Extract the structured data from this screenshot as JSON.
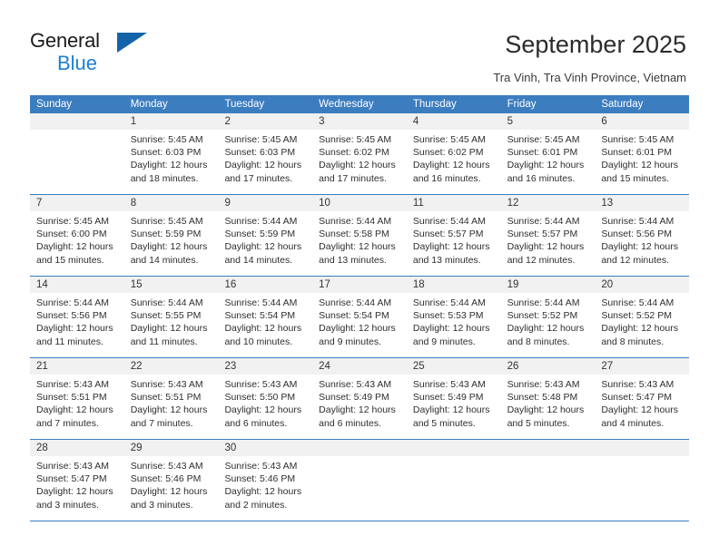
{
  "brand": {
    "line1": "General",
    "line2": "Blue",
    "triangle_color": "#1464aa",
    "blue_text_color": "#1d7fd4"
  },
  "header": {
    "title": "September 2025",
    "subtitle": "Tra Vinh, Tra Vinh Province, Vietnam"
  },
  "calendar": {
    "accent_color": "#3c7dc0",
    "day_band_color": "#f1f1f1",
    "weekday_headers": [
      "Sunday",
      "Monday",
      "Tuesday",
      "Wednesday",
      "Thursday",
      "Friday",
      "Saturday"
    ],
    "weeks": [
      [
        {
          "day": "",
          "sunrise": "",
          "sunset": "",
          "daylight1": "",
          "daylight2": ""
        },
        {
          "day": "1",
          "sunrise": "Sunrise: 5:45 AM",
          "sunset": "Sunset: 6:03 PM",
          "daylight1": "Daylight: 12 hours",
          "daylight2": "and 18 minutes."
        },
        {
          "day": "2",
          "sunrise": "Sunrise: 5:45 AM",
          "sunset": "Sunset: 6:03 PM",
          "daylight1": "Daylight: 12 hours",
          "daylight2": "and 17 minutes."
        },
        {
          "day": "3",
          "sunrise": "Sunrise: 5:45 AM",
          "sunset": "Sunset: 6:02 PM",
          "daylight1": "Daylight: 12 hours",
          "daylight2": "and 17 minutes."
        },
        {
          "day": "4",
          "sunrise": "Sunrise: 5:45 AM",
          "sunset": "Sunset: 6:02 PM",
          "daylight1": "Daylight: 12 hours",
          "daylight2": "and 16 minutes."
        },
        {
          "day": "5",
          "sunrise": "Sunrise: 5:45 AM",
          "sunset": "Sunset: 6:01 PM",
          "daylight1": "Daylight: 12 hours",
          "daylight2": "and 16 minutes."
        },
        {
          "day": "6",
          "sunrise": "Sunrise: 5:45 AM",
          "sunset": "Sunset: 6:01 PM",
          "daylight1": "Daylight: 12 hours",
          "daylight2": "and 15 minutes."
        }
      ],
      [
        {
          "day": "7",
          "sunrise": "Sunrise: 5:45 AM",
          "sunset": "Sunset: 6:00 PM",
          "daylight1": "Daylight: 12 hours",
          "daylight2": "and 15 minutes."
        },
        {
          "day": "8",
          "sunrise": "Sunrise: 5:45 AM",
          "sunset": "Sunset: 5:59 PM",
          "daylight1": "Daylight: 12 hours",
          "daylight2": "and 14 minutes."
        },
        {
          "day": "9",
          "sunrise": "Sunrise: 5:44 AM",
          "sunset": "Sunset: 5:59 PM",
          "daylight1": "Daylight: 12 hours",
          "daylight2": "and 14 minutes."
        },
        {
          "day": "10",
          "sunrise": "Sunrise: 5:44 AM",
          "sunset": "Sunset: 5:58 PM",
          "daylight1": "Daylight: 12 hours",
          "daylight2": "and 13 minutes."
        },
        {
          "day": "11",
          "sunrise": "Sunrise: 5:44 AM",
          "sunset": "Sunset: 5:57 PM",
          "daylight1": "Daylight: 12 hours",
          "daylight2": "and 13 minutes."
        },
        {
          "day": "12",
          "sunrise": "Sunrise: 5:44 AM",
          "sunset": "Sunset: 5:57 PM",
          "daylight1": "Daylight: 12 hours",
          "daylight2": "and 12 minutes."
        },
        {
          "day": "13",
          "sunrise": "Sunrise: 5:44 AM",
          "sunset": "Sunset: 5:56 PM",
          "daylight1": "Daylight: 12 hours",
          "daylight2": "and 12 minutes."
        }
      ],
      [
        {
          "day": "14",
          "sunrise": "Sunrise: 5:44 AM",
          "sunset": "Sunset: 5:56 PM",
          "daylight1": "Daylight: 12 hours",
          "daylight2": "and 11 minutes."
        },
        {
          "day": "15",
          "sunrise": "Sunrise: 5:44 AM",
          "sunset": "Sunset: 5:55 PM",
          "daylight1": "Daylight: 12 hours",
          "daylight2": "and 11 minutes."
        },
        {
          "day": "16",
          "sunrise": "Sunrise: 5:44 AM",
          "sunset": "Sunset: 5:54 PM",
          "daylight1": "Daylight: 12 hours",
          "daylight2": "and 10 minutes."
        },
        {
          "day": "17",
          "sunrise": "Sunrise: 5:44 AM",
          "sunset": "Sunset: 5:54 PM",
          "daylight1": "Daylight: 12 hours",
          "daylight2": "and 9 minutes."
        },
        {
          "day": "18",
          "sunrise": "Sunrise: 5:44 AM",
          "sunset": "Sunset: 5:53 PM",
          "daylight1": "Daylight: 12 hours",
          "daylight2": "and 9 minutes."
        },
        {
          "day": "19",
          "sunrise": "Sunrise: 5:44 AM",
          "sunset": "Sunset: 5:52 PM",
          "daylight1": "Daylight: 12 hours",
          "daylight2": "and 8 minutes."
        },
        {
          "day": "20",
          "sunrise": "Sunrise: 5:44 AM",
          "sunset": "Sunset: 5:52 PM",
          "daylight1": "Daylight: 12 hours",
          "daylight2": "and 8 minutes."
        }
      ],
      [
        {
          "day": "21",
          "sunrise": "Sunrise: 5:43 AM",
          "sunset": "Sunset: 5:51 PM",
          "daylight1": "Daylight: 12 hours",
          "daylight2": "and 7 minutes."
        },
        {
          "day": "22",
          "sunrise": "Sunrise: 5:43 AM",
          "sunset": "Sunset: 5:51 PM",
          "daylight1": "Daylight: 12 hours",
          "daylight2": "and 7 minutes."
        },
        {
          "day": "23",
          "sunrise": "Sunrise: 5:43 AM",
          "sunset": "Sunset: 5:50 PM",
          "daylight1": "Daylight: 12 hours",
          "daylight2": "and 6 minutes."
        },
        {
          "day": "24",
          "sunrise": "Sunrise: 5:43 AM",
          "sunset": "Sunset: 5:49 PM",
          "daylight1": "Daylight: 12 hours",
          "daylight2": "and 6 minutes."
        },
        {
          "day": "25",
          "sunrise": "Sunrise: 5:43 AM",
          "sunset": "Sunset: 5:49 PM",
          "daylight1": "Daylight: 12 hours",
          "daylight2": "and 5 minutes."
        },
        {
          "day": "26",
          "sunrise": "Sunrise: 5:43 AM",
          "sunset": "Sunset: 5:48 PM",
          "daylight1": "Daylight: 12 hours",
          "daylight2": "and 5 minutes."
        },
        {
          "day": "27",
          "sunrise": "Sunrise: 5:43 AM",
          "sunset": "Sunset: 5:47 PM",
          "daylight1": "Daylight: 12 hours",
          "daylight2": "and 4 minutes."
        }
      ],
      [
        {
          "day": "28",
          "sunrise": "Sunrise: 5:43 AM",
          "sunset": "Sunset: 5:47 PM",
          "daylight1": "Daylight: 12 hours",
          "daylight2": "and 3 minutes."
        },
        {
          "day": "29",
          "sunrise": "Sunrise: 5:43 AM",
          "sunset": "Sunset: 5:46 PM",
          "daylight1": "Daylight: 12 hours",
          "daylight2": "and 3 minutes."
        },
        {
          "day": "30",
          "sunrise": "Sunrise: 5:43 AM",
          "sunset": "Sunset: 5:46 PM",
          "daylight1": "Daylight: 12 hours",
          "daylight2": "and 2 minutes."
        },
        {
          "day": "",
          "sunrise": "",
          "sunset": "",
          "daylight1": "",
          "daylight2": ""
        },
        {
          "day": "",
          "sunrise": "",
          "sunset": "",
          "daylight1": "",
          "daylight2": ""
        },
        {
          "day": "",
          "sunrise": "",
          "sunset": "",
          "daylight1": "",
          "daylight2": ""
        },
        {
          "day": "",
          "sunrise": "",
          "sunset": "",
          "daylight1": "",
          "daylight2": ""
        }
      ]
    ]
  }
}
